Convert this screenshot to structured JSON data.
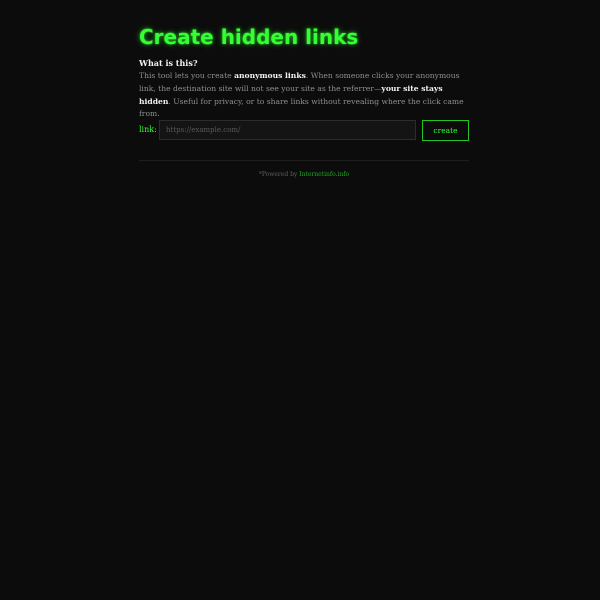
{
  "page": {
    "title": "Create hidden links"
  },
  "about": {
    "heading": "What is this?",
    "text_1": "This tool lets you create ",
    "bold_1": "anonymous links",
    "text_2": ". When someone clicks your anonymous link, the destination site will not see your site as the referrer—",
    "bold_2": "your site stays hidden",
    "text_3": ". Useful for privacy, or to share links without revealing where the click came from."
  },
  "form": {
    "label": "link:",
    "placeholder": "https://example.com/",
    "value": "",
    "button_label": "create"
  },
  "footer": {
    "prefix": "*Powered by ",
    "link_label": "Internetinfo.info"
  },
  "colors": {
    "accent": "#33ff33",
    "background": "#0c0c0c",
    "muted_text": "#8f8f8f",
    "emphasis_text": "#f2f2f2"
  }
}
